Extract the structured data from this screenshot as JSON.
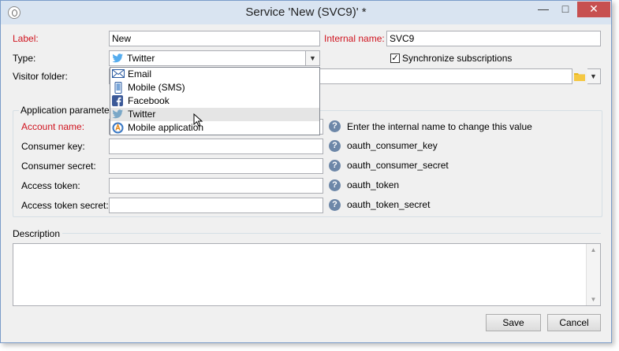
{
  "window": {
    "title": "Service 'New (SVC9)' *"
  },
  "form": {
    "label_label": "Label:",
    "label_value": "New",
    "internal_name_label": "Internal name:",
    "internal_name_value": "SVC9",
    "type_label": "Type:",
    "type_value": "Twitter",
    "sync_label": "Synchronize subscriptions",
    "sync_checked": true,
    "visitor_folder_label": "Visitor folder:"
  },
  "type_dropdown": {
    "options": [
      "Email",
      "Mobile (SMS)",
      "Facebook",
      "Twitter",
      "Mobile application"
    ],
    "highlighted": "Twitter"
  },
  "app_params": {
    "group_title": "Application parameters",
    "rows": [
      {
        "label": "Account name:",
        "hint": "Enter the internal name to change this value"
      },
      {
        "label": "Consumer key:",
        "hint": "oauth_consumer_key"
      },
      {
        "label": "Consumer secret:",
        "hint": "oauth_consumer_secret"
      },
      {
        "label": "Access token:",
        "hint": "oauth_token"
      },
      {
        "label": "Access token secret:",
        "hint": "oauth_token_secret"
      }
    ]
  },
  "description": {
    "group_title": "Description"
  },
  "buttons": {
    "save": "Save",
    "cancel": "Cancel"
  },
  "colors": {
    "required_label": "#d0141f",
    "close_button": "#c75050",
    "titlebar": "#d9e4f1",
    "twitter": "#55acee",
    "facebook": "#3b5998"
  }
}
